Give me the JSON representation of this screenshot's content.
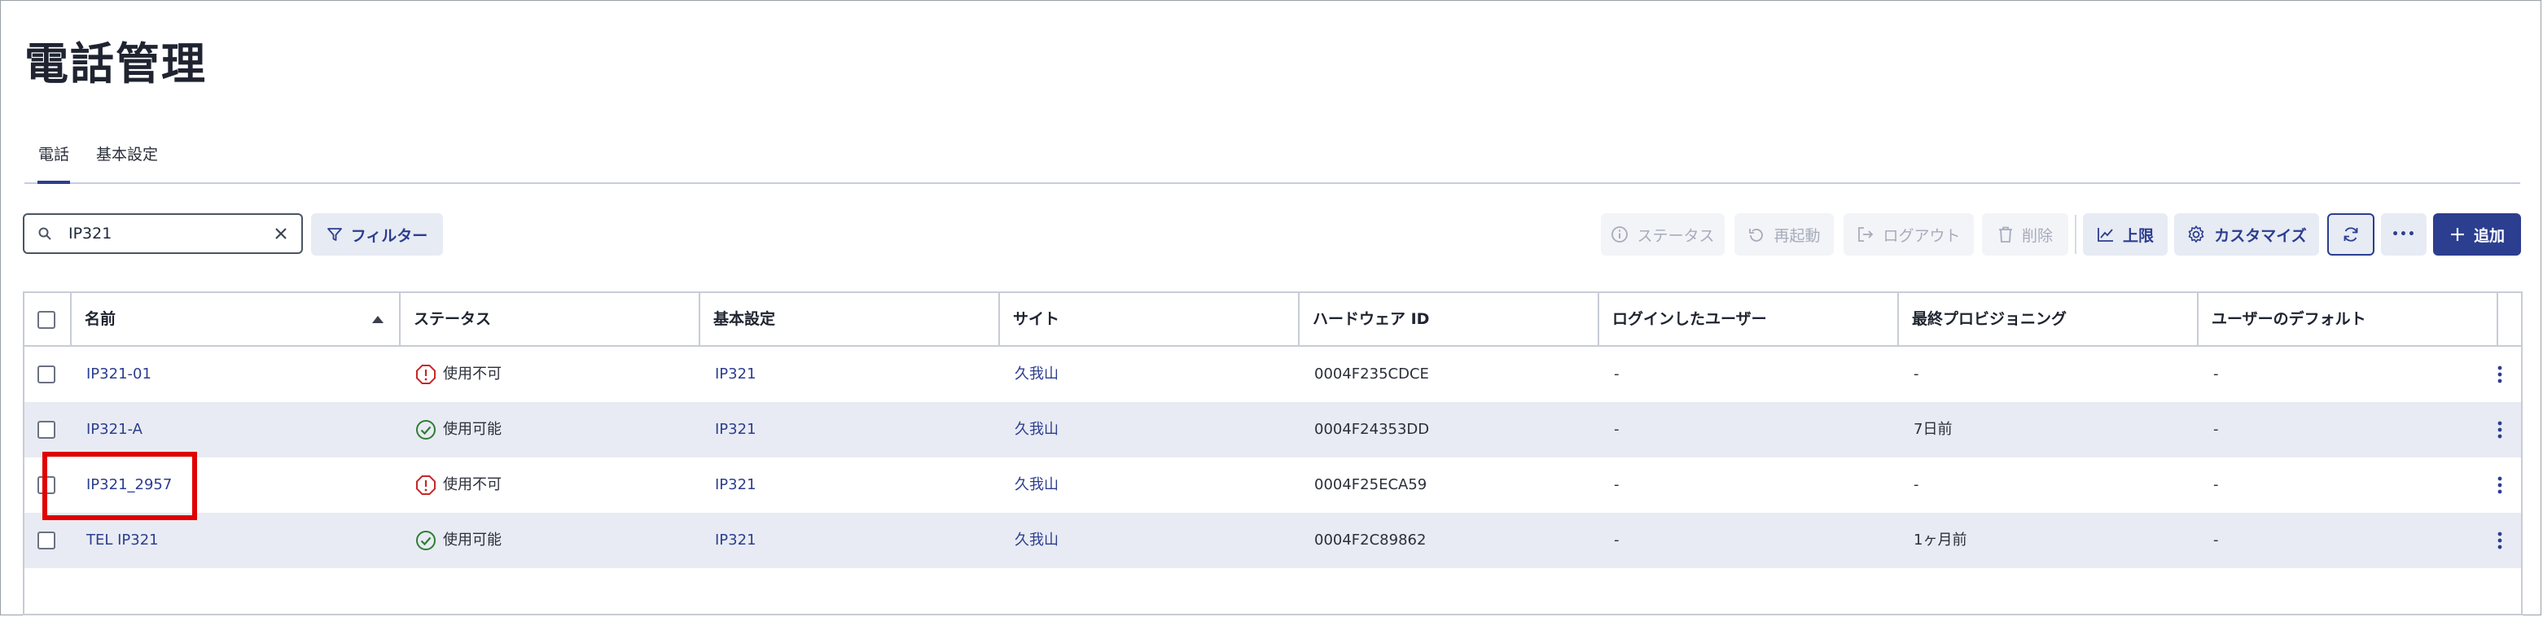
{
  "page": {
    "title": "電話管理"
  },
  "tabs": [
    {
      "label": "電話",
      "active": true
    },
    {
      "label": "基本設定",
      "active": false
    }
  ],
  "search": {
    "value": "IP321",
    "icon": "search-icon"
  },
  "toolbar": {
    "filter_label": "フィルター",
    "status_label": "ステータス",
    "restart_label": "再起動",
    "logout_label": "ログアウト",
    "delete_label": "削除",
    "limit_label": "上限",
    "customize_label": "カスタマイズ",
    "more_label": "•••",
    "add_label": "追加"
  },
  "table": {
    "columns": [
      "名前",
      "ステータス",
      "基本設定",
      "サイト",
      "ハードウェア ID",
      "ログインしたユーザー",
      "最終プロビジョニング",
      "ユーザーのデフォルト"
    ],
    "sort": {
      "column": "名前",
      "direction": "asc"
    },
    "rows": [
      {
        "name": "IP321-01",
        "status": "使用不可",
        "status_type": "error",
        "profile": "IP321",
        "site": "久我山",
        "hardware_id": "0004F235CDCE",
        "logged_user": "-",
        "last_provisioning": "-",
        "user_default": "-"
      },
      {
        "name": "IP321-A",
        "status": "使用可能",
        "status_type": "ok",
        "profile": "IP321",
        "site": "久我山",
        "hardware_id": "0004F24353DD",
        "logged_user": "-",
        "last_provisioning": "7日前",
        "user_default": "-"
      },
      {
        "name": "IP321_2957",
        "status": "使用不可",
        "status_type": "error",
        "profile": "IP321",
        "site": "久我山",
        "hardware_id": "0004F25ECA59",
        "logged_user": "-",
        "last_provisioning": "-",
        "user_default": "-"
      },
      {
        "name": "TEL IP321",
        "status": "使用可能",
        "status_type": "ok",
        "profile": "IP321",
        "site": "久我山",
        "hardware_id": "0004F2C89862",
        "logged_user": "-",
        "last_provisioning": "1ヶ月前",
        "user_default": "-"
      }
    ]
  },
  "colors": {
    "accent": "#2c3e8f",
    "error": "#c62828",
    "ok": "#2e7d32",
    "highlight": "#e00000",
    "row_alt": "#e8ebf3"
  }
}
